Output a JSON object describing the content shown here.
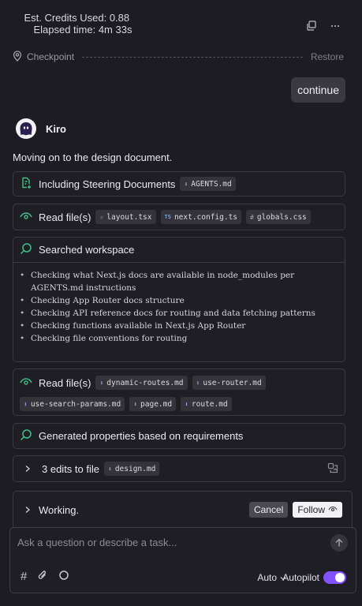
{
  "header": {
    "credits": "Est. Credits Used: 0.88",
    "elapsed": "Elapsed time: 4m 33s"
  },
  "checkpoint": {
    "label": "Checkpoint",
    "restore": "Restore"
  },
  "user_message": "continue",
  "agent": {
    "name": "Kiro",
    "message": "Moving on to the design document."
  },
  "steering": {
    "label": "Including Steering Documents",
    "file": "AGENTS.md"
  },
  "read1": {
    "label": "Read file(s)",
    "files": [
      "layout.tsx",
      "next.config.ts",
      "globals.css"
    ]
  },
  "search": {
    "label": "Searched workspace",
    "items": [
      "Checking what Next.js docs are available in node_modules per AGENTS.md instructions",
      "Checking App Router docs structure",
      "Checking API reference docs for routing and data fetching patterns",
      "Checking functions available in Next.js App Router",
      "Checking file conventions for routing"
    ]
  },
  "read2": {
    "label": "Read file(s)",
    "files": [
      "dynamic-routes.md",
      "use-router.md",
      "use-search-params.md",
      "page.md",
      "route.md"
    ]
  },
  "generated": {
    "label": "Generated properties based on requirements"
  },
  "edits": {
    "label": "3 edits to file",
    "file": "design.md"
  },
  "working": {
    "label": "Working.",
    "cancel": "Cancel",
    "follow": "Follow"
  },
  "composer": {
    "placeholder": "Ask a question or describe a task...",
    "mode": "Auto",
    "autopilot": "Autopilot",
    "autopilot_on": true
  },
  "colors": {
    "accent": "#8352ff",
    "success_icon": "#3fc08a",
    "background": "#1d1c22"
  }
}
